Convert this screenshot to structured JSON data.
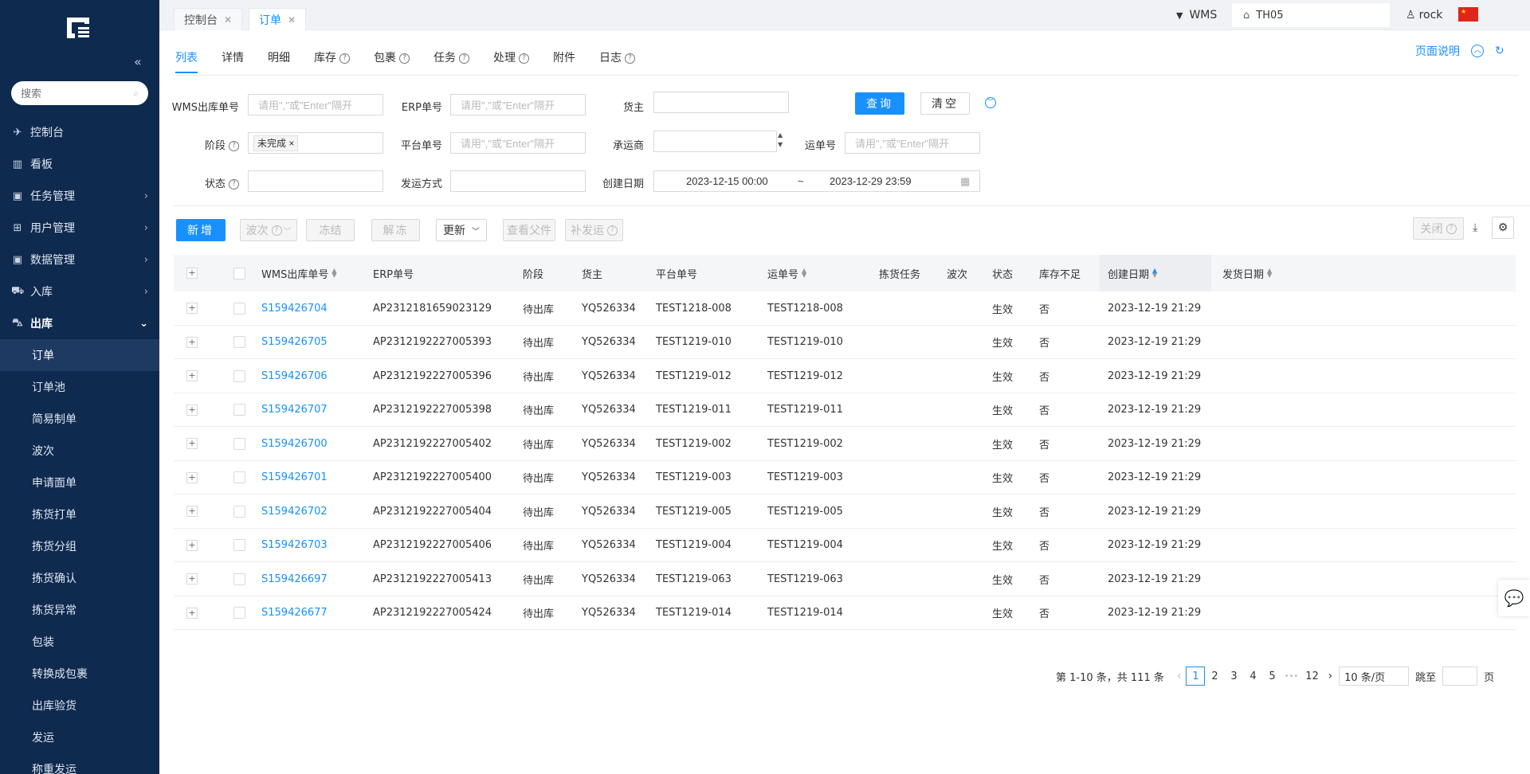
{
  "sidebar": {
    "search_placeholder": "搜索",
    "menu": [
      {
        "icon": "rocket-icon",
        "glyph": "✈",
        "label": "控制台",
        "has_arrow": false
      },
      {
        "icon": "bar-chart-icon",
        "glyph": "▥",
        "label": "看板",
        "has_arrow": false
      },
      {
        "icon": "lock-icon",
        "glyph": "▣",
        "label": "任务管理",
        "has_arrow": true
      },
      {
        "icon": "grid-icon",
        "glyph": "⊞",
        "label": "用户管理",
        "has_arrow": true
      },
      {
        "icon": "lock-icon",
        "glyph": "▣",
        "label": "数据管理",
        "has_arrow": true
      },
      {
        "icon": "cart-icon",
        "glyph": "⛟",
        "label": "入库",
        "has_arrow": true
      },
      {
        "icon": "car-icon",
        "glyph": "⛍",
        "label": "出库",
        "has_arrow": true
      }
    ],
    "submenu": [
      "订单",
      "订单池",
      "简易制单",
      "波次",
      "申请面单",
      "拣货打单",
      "拣货分组",
      "拣货确认",
      "拣货异常",
      "包装",
      "转换成包裹",
      "出库验货",
      "发运",
      "称重发运"
    ]
  },
  "topbar": {
    "tabs": [
      "控制台",
      "订单"
    ],
    "system": "WMS",
    "warehouse": "TH05",
    "user": "rock"
  },
  "subtabs": [
    "列表",
    "详情",
    "明细",
    "库存",
    "包裹",
    "任务",
    "处理",
    "附件",
    "日志"
  ],
  "page_help": "页面说明",
  "filters": {
    "wms_no_label": "WMS出库单号",
    "wms_no_placeholder": "请用\",\"或\"Enter\"隔开",
    "erp_label": "ERP单号",
    "erp_placeholder": "请用\",\"或\"Enter\"隔开",
    "owner_label": "货主",
    "stage_label": "阶段",
    "stage_tag": "未完成",
    "platform_label": "平台单号",
    "platform_placeholder": "请用\",\"或\"Enter\"隔开",
    "carrier_label": "承运商",
    "waybill_label": "运单号",
    "waybill_placeholder": "请用\",\"或\"Enter\"隔开",
    "status_label": "状态",
    "ship_method_label": "发运方式",
    "created_label": "创建日期",
    "date_from": "2023-12-15 00:00",
    "date_sep": "~",
    "date_to": "2023-12-29 23:59",
    "query_btn": "查询",
    "clear_btn": "清空"
  },
  "toolbar": {
    "new": "新增",
    "wave": "波次",
    "freeze": "冻结",
    "unfreeze": "解冻",
    "update": "更新",
    "view_parent": "查看父件",
    "reship": "补发运",
    "close": "关闭"
  },
  "table": {
    "columns": [
      "WMS出库单号",
      "ERP单号",
      "阶段",
      "货主",
      "平台单号",
      "运单号",
      "拣货任务",
      "波次",
      "状态",
      "库存不足",
      "创建日期",
      "发货日期"
    ],
    "rows": [
      {
        "wms": "S159426704",
        "erp": "AP2312181659023129",
        "stage": "待出库",
        "owner": "YQ526334",
        "platform": "TEST1218-008",
        "waybill": "TEST1218-008",
        "status": "生效",
        "short": "否",
        "created": "2023-12-19 21:29"
      },
      {
        "wms": "S159426705",
        "erp": "AP2312192227005393",
        "stage": "待出库",
        "owner": "YQ526334",
        "platform": "TEST1219-010",
        "waybill": "TEST1219-010",
        "status": "生效",
        "short": "否",
        "created": "2023-12-19 21:29"
      },
      {
        "wms": "S159426706",
        "erp": "AP2312192227005396",
        "stage": "待出库",
        "owner": "YQ526334",
        "platform": "TEST1219-012",
        "waybill": "TEST1219-012",
        "status": "生效",
        "short": "否",
        "created": "2023-12-19 21:29"
      },
      {
        "wms": "S159426707",
        "erp": "AP2312192227005398",
        "stage": "待出库",
        "owner": "YQ526334",
        "platform": "TEST1219-011",
        "waybill": "TEST1219-011",
        "status": "生效",
        "short": "否",
        "created": "2023-12-19 21:29"
      },
      {
        "wms": "S159426700",
        "erp": "AP2312192227005402",
        "stage": "待出库",
        "owner": "YQ526334",
        "platform": "TEST1219-002",
        "waybill": "TEST1219-002",
        "status": "生效",
        "short": "否",
        "created": "2023-12-19 21:29"
      },
      {
        "wms": "S159426701",
        "erp": "AP2312192227005400",
        "stage": "待出库",
        "owner": "YQ526334",
        "platform": "TEST1219-003",
        "waybill": "TEST1219-003",
        "status": "生效",
        "short": "否",
        "created": "2023-12-19 21:29"
      },
      {
        "wms": "S159426702",
        "erp": "AP2312192227005404",
        "stage": "待出库",
        "owner": "YQ526334",
        "platform": "TEST1219-005",
        "waybill": "TEST1219-005",
        "status": "生效",
        "short": "否",
        "created": "2023-12-19 21:29"
      },
      {
        "wms": "S159426703",
        "erp": "AP2312192227005406",
        "stage": "待出库",
        "owner": "YQ526334",
        "platform": "TEST1219-004",
        "waybill": "TEST1219-004",
        "status": "生效",
        "short": "否",
        "created": "2023-12-19 21:29"
      },
      {
        "wms": "S159426697",
        "erp": "AP2312192227005413",
        "stage": "待出库",
        "owner": "YQ526334",
        "platform": "TEST1219-063",
        "waybill": "TEST1219-063",
        "status": "生效",
        "short": "否",
        "created": "2023-12-19 21:29"
      },
      {
        "wms": "S159426677",
        "erp": "AP2312192227005424",
        "stage": "待出库",
        "owner": "YQ526334",
        "platform": "TEST1219-014",
        "waybill": "TEST1219-014",
        "status": "生效",
        "short": "否",
        "created": "2023-12-19 21:29"
      }
    ]
  },
  "pagination": {
    "summary": "第 1-10 条，共 111 条",
    "pages": [
      "1",
      "2",
      "3",
      "4",
      "5"
    ],
    "ellipsis": "•••",
    "last": "12",
    "page_size": "10 条/页",
    "jump_label": "跳至",
    "page_suffix": "页"
  },
  "colors": {
    "primary": "#1890ff",
    "sidebar": "#0f2a4f"
  }
}
